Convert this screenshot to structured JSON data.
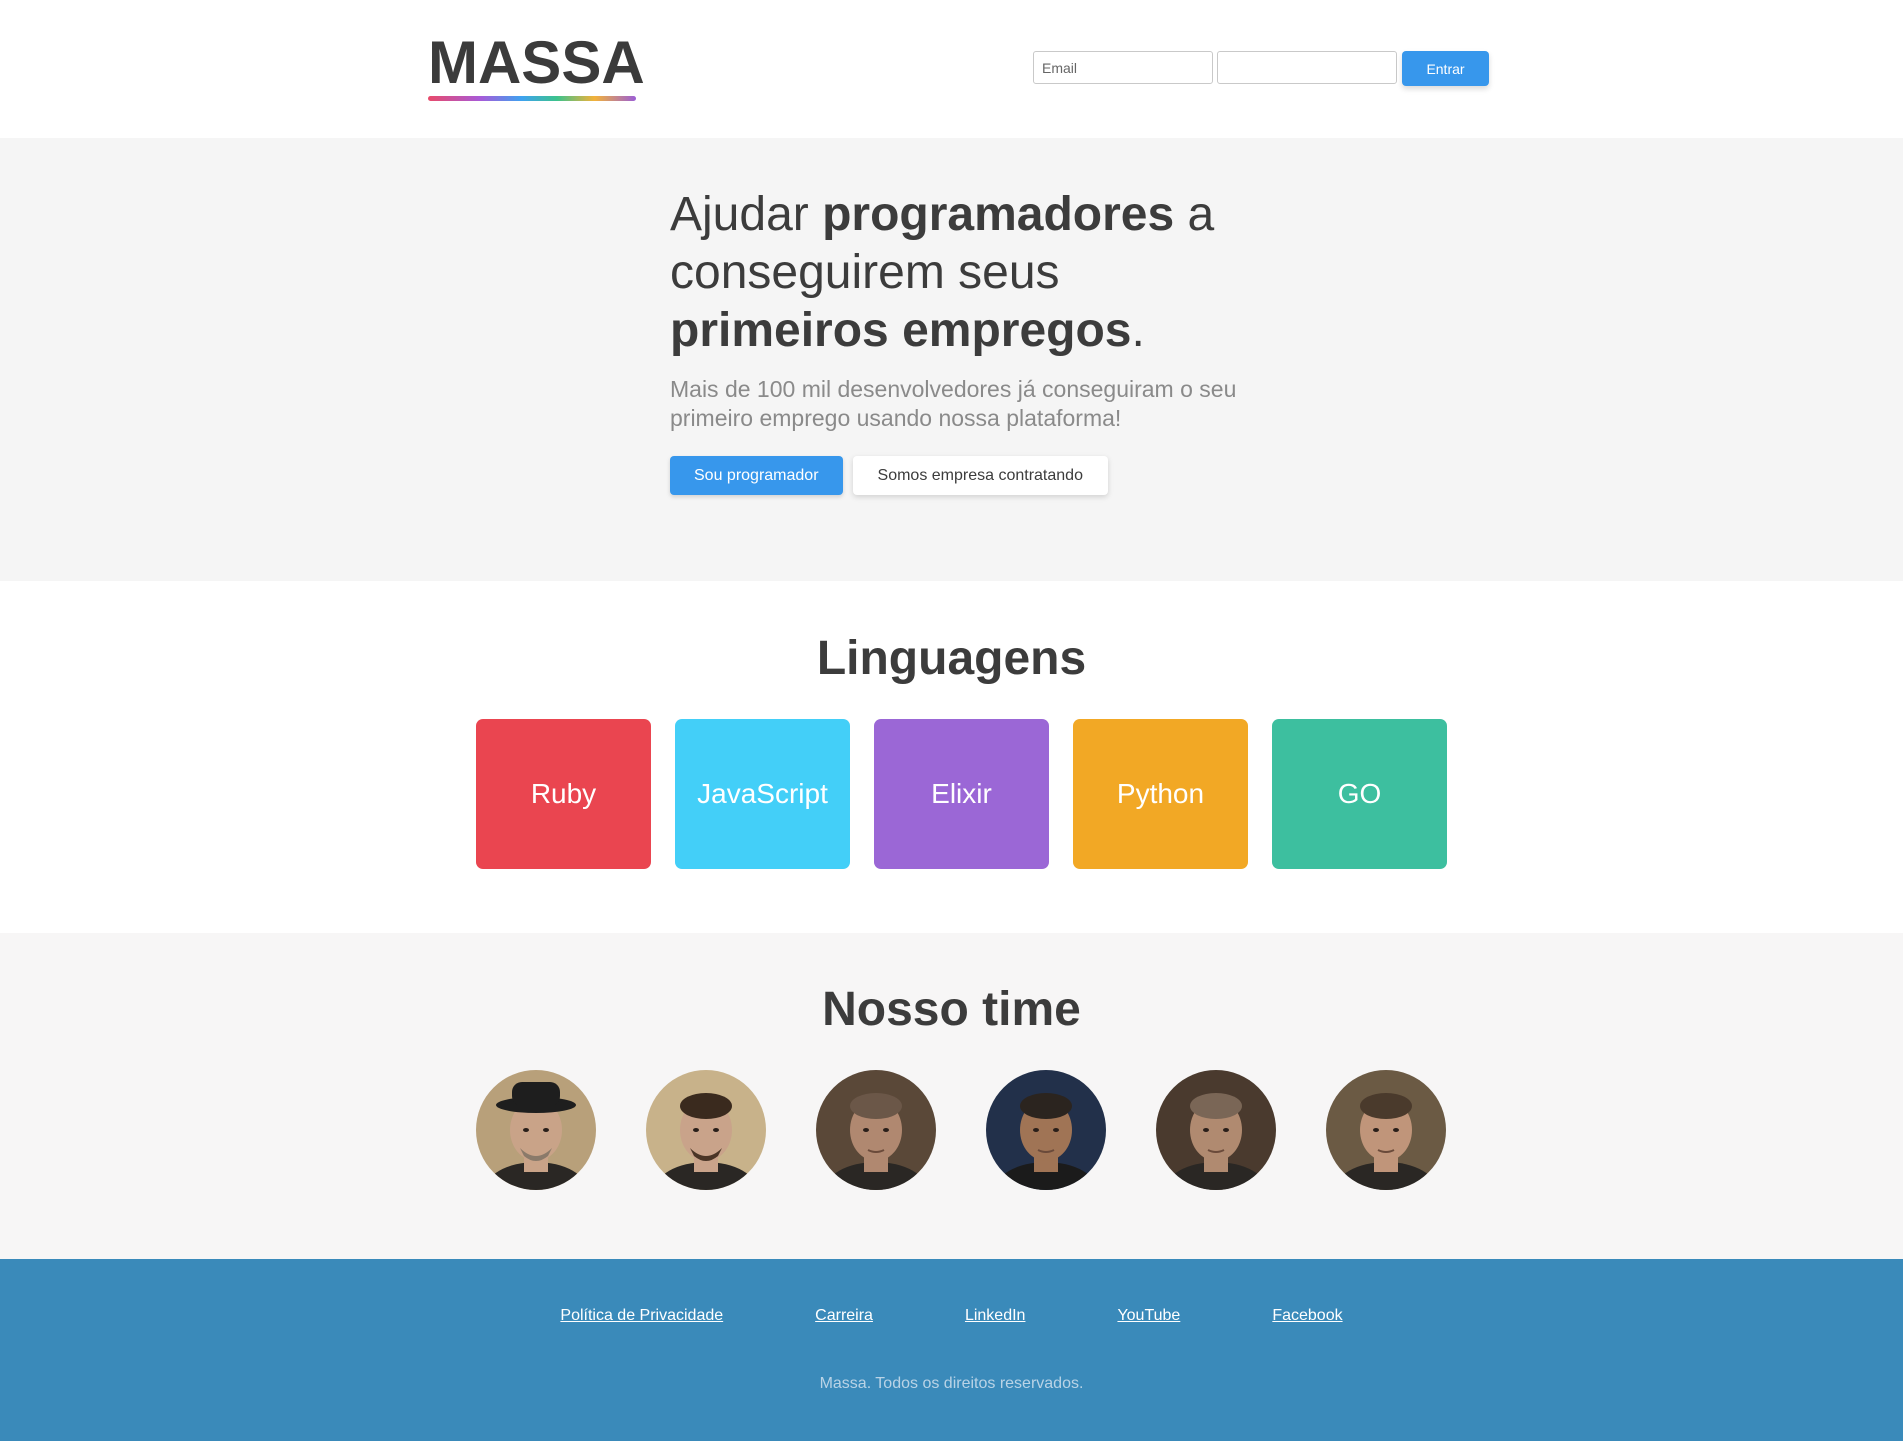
{
  "header": {
    "logo": "MASSA",
    "email_placeholder": "Email",
    "password_placeholder": "",
    "login_button": "Entrar"
  },
  "hero": {
    "title_1": "Ajudar ",
    "title_bold_1": "programadores",
    "title_2": " a conseguirem seus ",
    "title_bold_2": "primeiros empregos",
    "title_3": ".",
    "subtitle": "Mais de 100 mil desenvolvedores já conseguiram o seu primeiro emprego usando nossa plataforma!",
    "primary_button": "Sou programador",
    "secondary_button": "Somos empresa contratando"
  },
  "languages": {
    "title": "Linguagens",
    "items": [
      {
        "label": "Ruby",
        "color": "#ea4550"
      },
      {
        "label": "JavaScript",
        "color": "#43cff8"
      },
      {
        "label": "Elixir",
        "color": "#9b67d6"
      },
      {
        "label": "Python",
        "color": "#f2a825"
      },
      {
        "label": "GO",
        "color": "#3dbf9f"
      }
    ]
  },
  "team": {
    "title": "Nosso time",
    "members": [
      {
        "name": "team-member-1",
        "bg": "#b8a07a",
        "skin": "#c9a388",
        "hair": "#2a2a2a"
      },
      {
        "name": "team-member-2",
        "bg": "#c8b28a",
        "skin": "#c9a38a",
        "hair": "#3a2a1e"
      },
      {
        "name": "team-member-3",
        "bg": "#5a4838",
        "skin": "#b08870",
        "hair": "#6b5748"
      },
      {
        "name": "team-member-4",
        "bg": "#22304a",
        "skin": "#a07455",
        "hair": "#2b241f"
      },
      {
        "name": "team-member-5",
        "bg": "#4a3a2e",
        "skin": "#b08a70",
        "hair": "#7a6656"
      },
      {
        "name": "team-member-6",
        "bg": "#6b5a44",
        "skin": "#c0957a",
        "hair": "#4a3a2c"
      }
    ]
  },
  "footer": {
    "links": [
      "Política de Privacidade",
      "Carreira",
      "LinkedIn",
      "YouTube",
      "Facebook"
    ],
    "copyright": "Massa. Todos os direitos reservados."
  }
}
